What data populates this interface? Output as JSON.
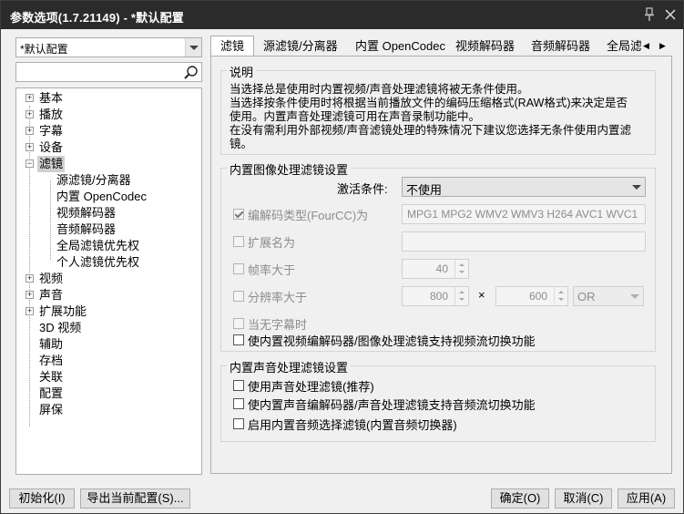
{
  "window": {
    "title": "参数选项(1.7.21149) - *默认配置"
  },
  "profile": {
    "selected": "*默认配置"
  },
  "search": {
    "value": ""
  },
  "tree": {
    "items": [
      {
        "label": "基本",
        "expand": "+"
      },
      {
        "label": "播放",
        "expand": "+"
      },
      {
        "label": "字幕",
        "expand": "+"
      },
      {
        "label": "设备",
        "expand": "+"
      },
      {
        "label": "滤镜",
        "expand": "−"
      },
      {
        "label": "源滤镜/分离器"
      },
      {
        "label": "内置 OpenCodec"
      },
      {
        "label": "视频解码器"
      },
      {
        "label": "音频解码器"
      },
      {
        "label": "全局滤镜优先权"
      },
      {
        "label": "个人滤镜优先权"
      },
      {
        "label": "视频",
        "expand": "+"
      },
      {
        "label": "声音",
        "expand": "+"
      },
      {
        "label": "扩展功能",
        "expand": "+"
      },
      {
        "label": "3D 视频"
      },
      {
        "label": "辅助"
      },
      {
        "label": "存档"
      },
      {
        "label": "关联"
      },
      {
        "label": "配置"
      },
      {
        "label": "屏保"
      }
    ]
  },
  "tabs": [
    "滤镜",
    "源滤镜/分离器",
    "内置 OpenCodec",
    "视频解码器",
    "音频解码器",
    "全局滤"
  ],
  "tab_scroll": {
    "left": "◀",
    "right": "▶"
  },
  "description": {
    "title": "说明",
    "lines": [
      "当选择总是使用时内置视频/声音处理滤镜将被无条件使用。",
      "当选择按条件使用时将根据当前播放文件的编码压缩格式(RAW格式)来决定是否",
      "使用。内置声音处理滤镜可用在声音录制功能中。",
      "在没有需利用外部视频/声音滤镜处理的特殊情况下建议您选择无条件使用内置滤",
      "镜。"
    ]
  },
  "video_group": {
    "title": "内置图像处理滤镜设置",
    "activation_label": "激活条件:",
    "activation_value": "不使用",
    "fourcc_label": "编解码类型(FourCC)为",
    "fourcc_value": "MPG1 MPG2 WMV2 WMV3 H264 AVC1 WVC1",
    "extension_label": "扩展名为",
    "extension_value": "",
    "framerate_label": "帧率大于",
    "framerate_value": "40",
    "resolution_label": "分辨率大于",
    "res_width": "800",
    "res_times": "×",
    "res_height": "600",
    "res_op": "OR",
    "no_subtitle_label": "当无字幕时",
    "switch_label": "使内置视频编解码器/图像处理滤镜支持视频流切换功能"
  },
  "audio_group": {
    "title": "内置声音处理滤镜设置",
    "use_audio_label": "使用声音处理滤镜(推荐)",
    "audio_switch_label": "使内置声音编解码器/声音处理滤镜支持音频流切换功能",
    "audio_selector_label": "启用内置音频选择滤镜(内置音频切换器)"
  },
  "buttons": {
    "init": "初始化(I)",
    "export": "导出当前配置(S)...",
    "ok": "确定(O)",
    "cancel": "取消(C)",
    "apply": "应用(A)"
  }
}
